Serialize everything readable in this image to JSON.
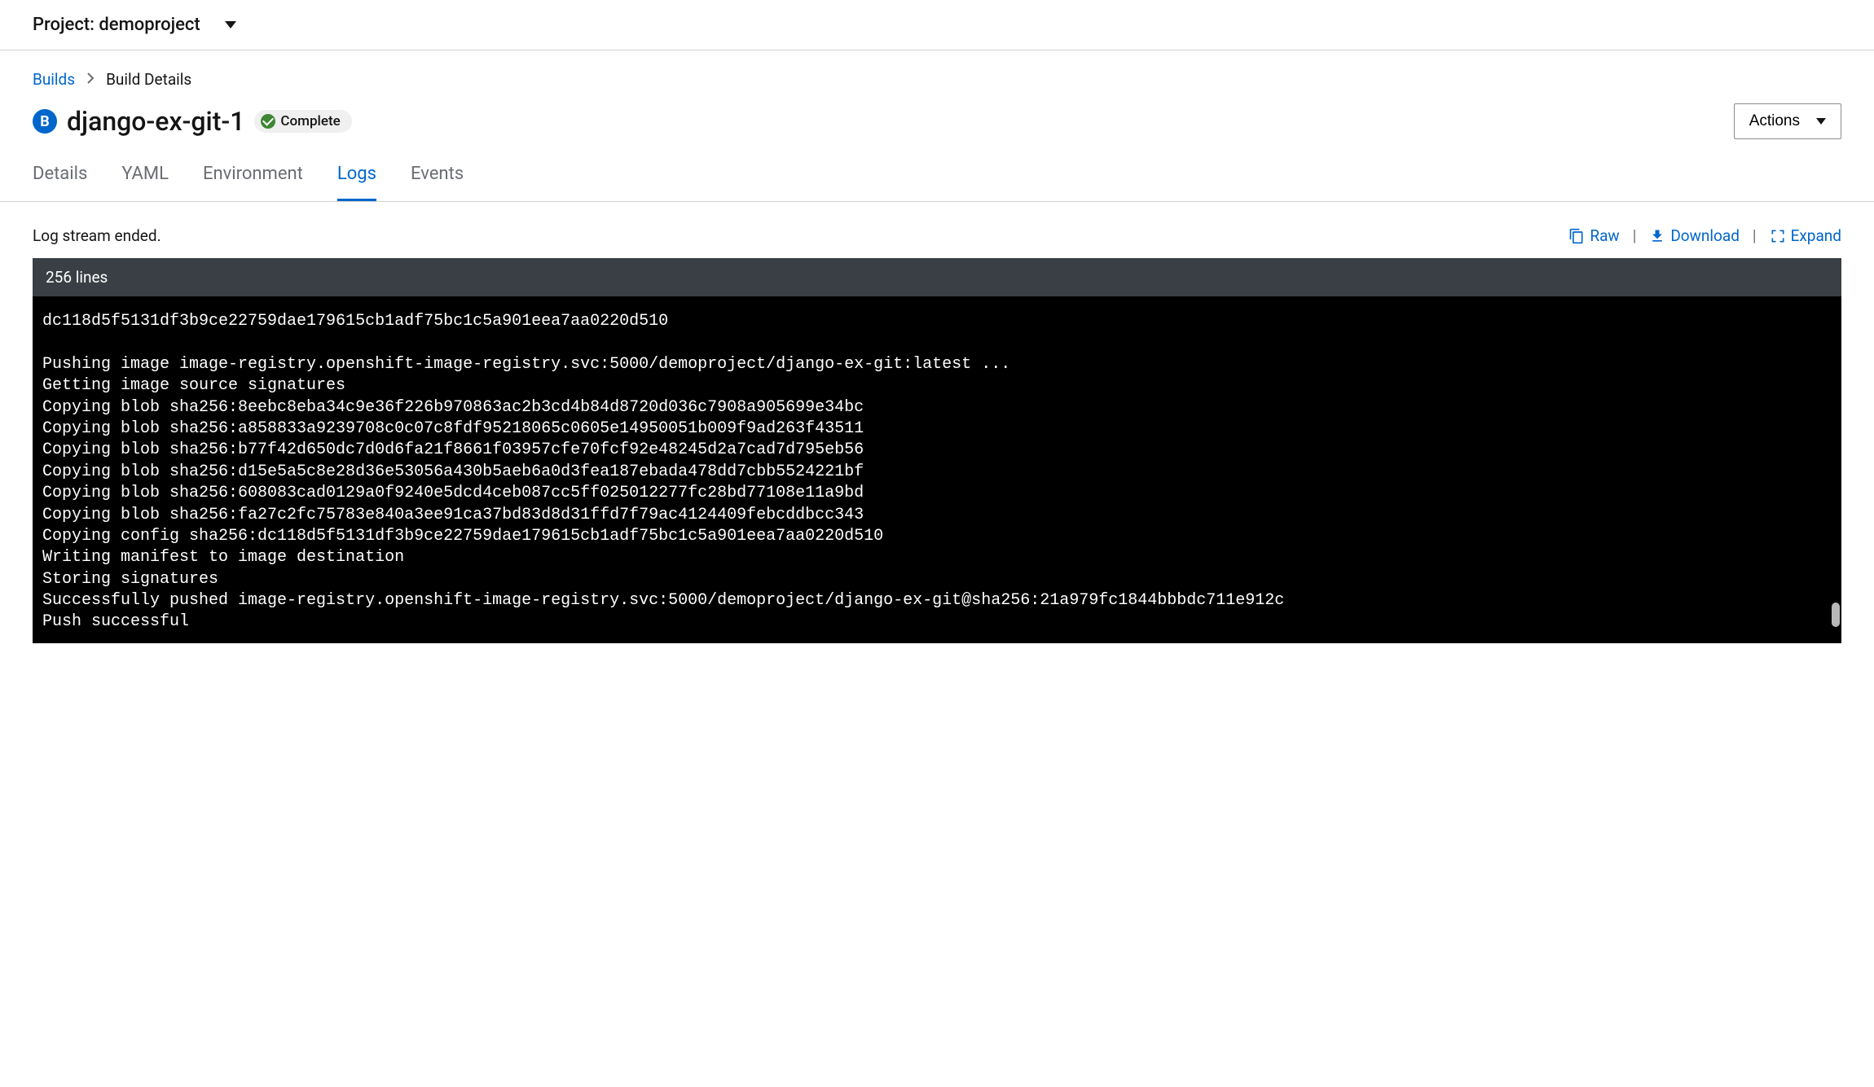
{
  "project": {
    "label": "Project: demoproject"
  },
  "breadcrumb": {
    "root": "Builds",
    "current": "Build Details"
  },
  "title": {
    "icon_letter": "B",
    "name": "django-ex-git-1"
  },
  "status": {
    "label": "Complete"
  },
  "actions": {
    "label": "Actions"
  },
  "tabs": {
    "items": [
      {
        "label": "Details",
        "active": false
      },
      {
        "label": "YAML",
        "active": false
      },
      {
        "label": "Environment",
        "active": false
      },
      {
        "label": "Logs",
        "active": true
      },
      {
        "label": "Events",
        "active": false
      }
    ]
  },
  "logs": {
    "status_text": "Log stream ended.",
    "line_count": "256 lines",
    "raw_label": "Raw",
    "download_label": "Download",
    "expand_label": "Expand",
    "content": "dc118d5f5131df3b9ce22759dae179615cb1adf75bc1c5a901eea7aa0220d510\n\nPushing image image-registry.openshift-image-registry.svc:5000/demoproject/django-ex-git:latest ...\nGetting image source signatures\nCopying blob sha256:8eebc8eba34c9e36f226b970863ac2b3cd4b84d8720d036c7908a905699e34bc\nCopying blob sha256:a858833a9239708c0c07c8fdf95218065c0605e14950051b009f9ad263f43511\nCopying blob sha256:b77f42d650dc7d0d6fa21f8661f03957cfe70fcf92e48245d2a7cad7d795eb56\nCopying blob sha256:d15e5a5c8e28d36e53056a430b5aeb6a0d3fea187ebada478dd7cbb5524221bf\nCopying blob sha256:608083cad0129a0f9240e5dcd4ceb087cc5ff025012277fc28bd77108e11a9bd\nCopying blob sha256:fa27c2fc75783e840a3ee91ca37bd83d8d31ffd7f79ac4124409febcddbcc343\nCopying config sha256:dc118d5f5131df3b9ce22759dae179615cb1adf75bc1c5a901eea7aa0220d510\nWriting manifest to image destination\nStoring signatures\nSuccessfully pushed image-registry.openshift-image-registry.svc:5000/demoproject/django-ex-git@sha256:21a979fc1844bbbdc711e912c\nPush successful"
  }
}
